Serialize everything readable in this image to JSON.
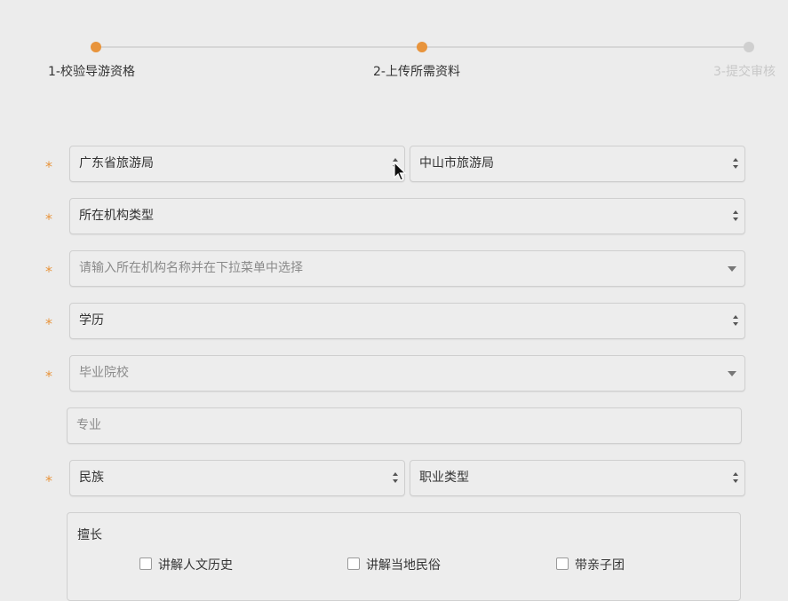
{
  "stepper": {
    "steps": [
      {
        "label": "1-校验导游资格",
        "state": "active"
      },
      {
        "label": "2-上传所需资料",
        "state": "active"
      },
      {
        "label": "3-提交审核",
        "state": "inactive"
      }
    ],
    "colors": {
      "active": "#e8943c",
      "inactive": "#cfcfcf"
    }
  },
  "form": {
    "required_marker": "*",
    "province_select": "广东省旅游局",
    "city_select": "中山市旅游局",
    "org_type_select": "所在机构类型",
    "org_name_placeholder": "请输入所在机构名称并在下拉菜单中选择",
    "education_select": "学历",
    "school_placeholder": "毕业院校",
    "major_placeholder": "专业",
    "ethnicity_select": "民族",
    "job_type_select": "职业类型"
  },
  "specialty": {
    "title": "擅长",
    "options": [
      "讲解人文历史",
      "讲解当地民俗",
      "带亲子团"
    ]
  }
}
